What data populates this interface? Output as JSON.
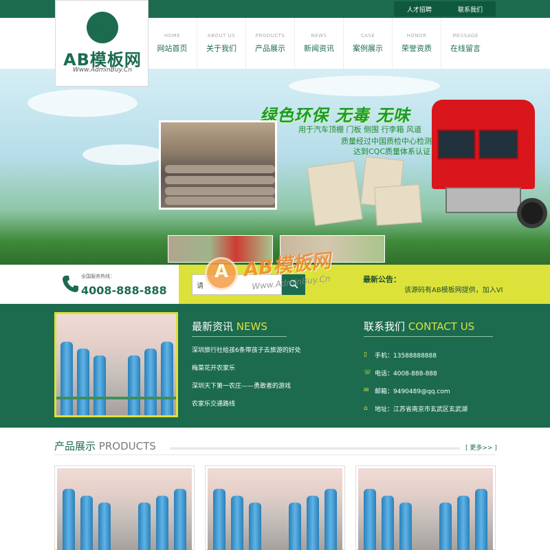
{
  "top_links": [
    "人才招聘",
    "联系我们"
  ],
  "logo": {
    "mark": "A",
    "name": "AB模板网",
    "url": "Www.AdminBuy.Cn"
  },
  "nav": [
    {
      "en": "HOME",
      "cn": "网站首页"
    },
    {
      "en": "ABOUT US",
      "cn": "关于我们"
    },
    {
      "en": "PRODUCTS",
      "cn": "产品展示"
    },
    {
      "en": "NEWS",
      "cn": "新闻资讯"
    },
    {
      "en": "CASE",
      "cn": "案例展示"
    },
    {
      "en": "HONOR",
      "cn": "荣誉资质"
    },
    {
      "en": "MESSAGE",
      "cn": "在线留言"
    }
  ],
  "banner": {
    "slogan": "绿色环保 无毒 无味",
    "lines": [
      "用于汽车顶棚 门板 侧围 行李箱 风道",
      "质量经过中国质检中心检测",
      "达到CQC质量体系认证"
    ]
  },
  "service": {
    "hotline_label": "全国服务热线：",
    "hotline": "4008-888-888",
    "search_value": "请",
    "notice_label": "最新公告：",
    "notice_text": "该源码有AB模板网提供，加入VI"
  },
  "watermark": {
    "mark": "A",
    "text": "AB模板网",
    "sub": "Www.AdminBuy.Cn"
  },
  "news": {
    "title_cn": "最新资讯",
    "title_en": "NEWS",
    "items": [
      "深圳旅行社给孩6条带孩子去旅游的好处",
      "梅菜花开农家乐",
      "深圳天下第一农庄——勇敢者的游戏",
      "农家乐交通路线"
    ]
  },
  "contact": {
    "title_cn": "联系我们",
    "title_en": "CONTACT US",
    "items": [
      {
        "icon": "mobile-icon",
        "text": "手机：13588888888"
      },
      {
        "icon": "phone-icon",
        "text": "电话：4008-888-888"
      },
      {
        "icon": "mail-icon",
        "text": "邮箱：9490489@qq.com"
      },
      {
        "icon": "location-icon",
        "text": "地址：江苏省南京市玄武区玄武湖"
      }
    ]
  },
  "products": {
    "title_cn": "产品展示",
    "title_en": "PRODUCTS",
    "more": "[ 更多>> ]"
  },
  "colors": {
    "brand_green": "#1c6b4f",
    "accent_yellow": "#dde23a"
  }
}
